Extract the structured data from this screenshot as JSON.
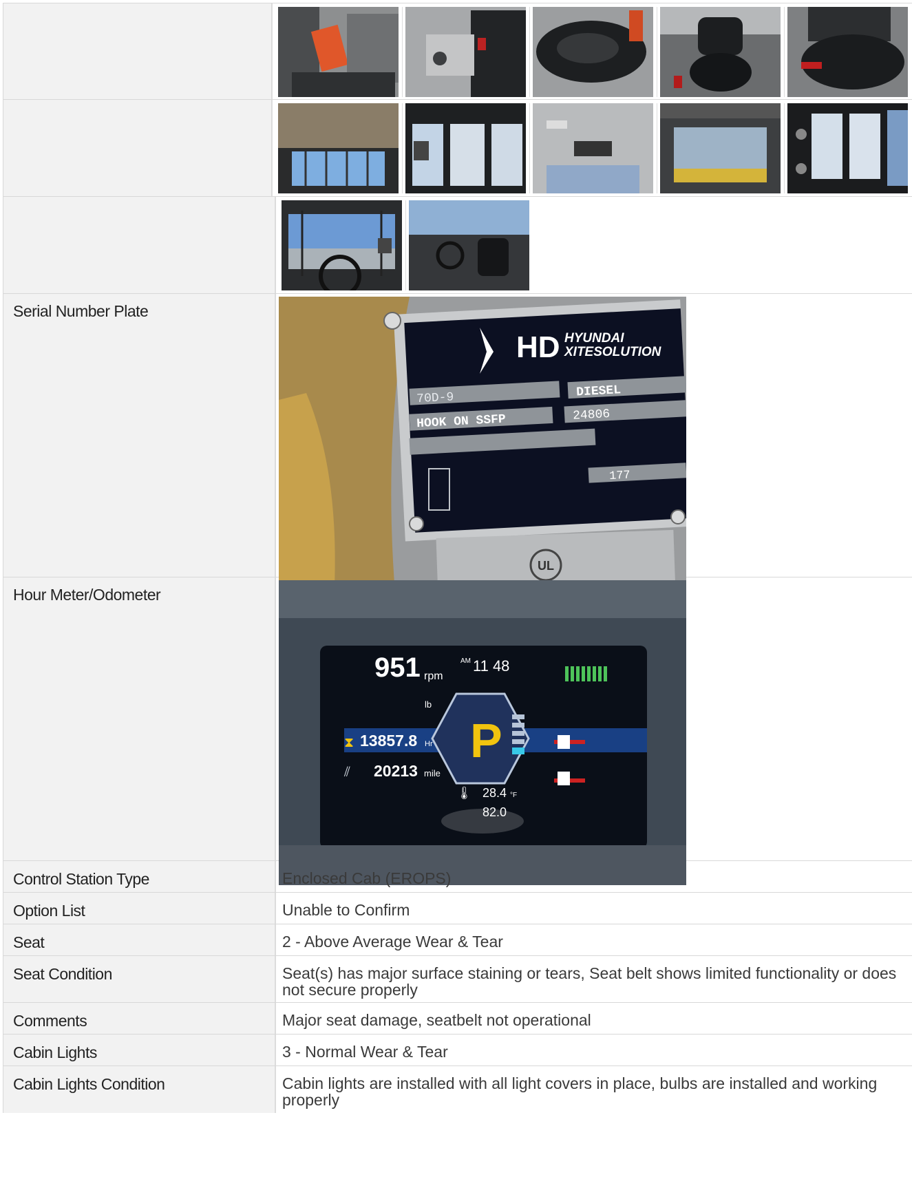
{
  "gallery_rows": [
    {
      "label": "",
      "thumbs": [
        "cab-interior-photo",
        "seat-side-photo",
        "seat-top-photo",
        "seat-front-photo",
        "seat-closeup-photo"
      ]
    },
    {
      "label": "",
      "thumbs": [
        "cab-roof-photo",
        "cab-interior-doors-photo",
        "cab-ceiling-photo",
        "windshield-photo",
        "rear-window-photo"
      ]
    },
    {
      "label": "",
      "thumbs": [
        "steering-view-photo",
        "operator-station-photo"
      ]
    }
  ],
  "serial_plate": {
    "label": "Serial Number Plate",
    "plate_text": {
      "brand_mark": "HD",
      "brand_line1": "HYUNDAI",
      "brand_line2": "XITESOLUTION",
      "type": "DIESEL",
      "model": "70D-9",
      "attachments": "HOOK ON SSFP",
      "truck_weight": "24806",
      "max_lift": "177",
      "ul_mark": "UL"
    }
  },
  "hour_meter": {
    "label": "Hour Meter/Odometer",
    "display": {
      "rpm": "951",
      "rpm_unit": "rpm",
      "time": "11 48",
      "am": "AM",
      "gear": "P",
      "hours": "13857.8",
      "hours_unit": "Hr",
      "miles": "20213",
      "miles_unit": "mile",
      "lb_unit": "lb",
      "temp": "28.4",
      "temp_unit": "°F",
      "temp2": "82.0"
    }
  },
  "fields": [
    {
      "label": "Control Station Type",
      "value": "Enclosed Cab (EROPS)"
    },
    {
      "label": "Option List",
      "value": "Unable to Confirm"
    },
    {
      "label": "Seat",
      "value": "2 - Above Average Wear & Tear"
    },
    {
      "label": "Seat Condition",
      "value": "Seat(s) has major surface staining or tears, Seat belt shows limited functionality or does not secure properly"
    },
    {
      "label": "Comments",
      "value": "Major seat damage, seatbelt not operational"
    },
    {
      "label": "Cabin Lights",
      "value": "3 - Normal Wear & Tear"
    },
    {
      "label": "Cabin Lights Condition",
      "value": "Cabin lights are installed with all light covers in place, bulbs are installed and working properly"
    }
  ]
}
